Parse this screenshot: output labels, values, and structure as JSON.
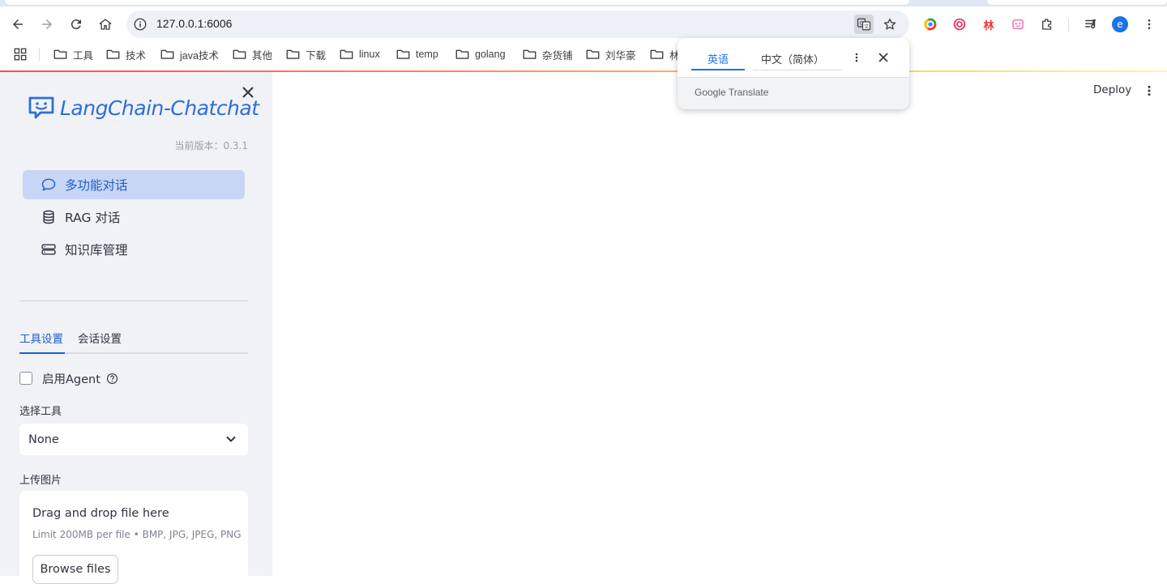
{
  "browser": {
    "url": "127.0.0.1:6006",
    "bookmarks": [
      {
        "label": "工具"
      },
      {
        "label": "技术"
      },
      {
        "label": "java技术"
      },
      {
        "label": "其他"
      },
      {
        "label": "下载"
      },
      {
        "label": "linux"
      },
      {
        "label": "temp"
      },
      {
        "label": "golang"
      },
      {
        "label": "杂货铺"
      },
      {
        "label": "刘华豪"
      },
      {
        "label": "林"
      }
    ],
    "extensions": {
      "lin_label": "林",
      "profile_initial": "e"
    },
    "icons": [
      "back-icon",
      "forward-icon",
      "reload-icon",
      "home-icon",
      "info-icon",
      "translate-icon",
      "star-icon",
      "extensions-icon",
      "media-icon",
      "kebab-menu-icon",
      "apps-icon",
      "folder-icon"
    ]
  },
  "translate_popup": {
    "source_language": "英语",
    "target_language": "中文（简体）",
    "brand": "Google Translate"
  },
  "sidebar": {
    "logo_text": "LangChain-Chatchat",
    "version": "当前版本：0.3.1",
    "menu": [
      {
        "label": "多功能对话",
        "icon": "chat-bubble-icon",
        "active": true
      },
      {
        "label": "RAG 对话",
        "icon": "database-icon",
        "active": false
      },
      {
        "label": "知识库管理",
        "icon": "server-icon",
        "active": false
      }
    ],
    "tabs": [
      {
        "label": "工具设置",
        "active": true
      },
      {
        "label": "会话设置",
        "active": false
      }
    ],
    "agent": {
      "label": "启用Agent",
      "checked": false
    },
    "tool_select": {
      "label": "选择工具",
      "value": "None"
    },
    "upload": {
      "label": "上传图片",
      "title": "Drag and drop file here",
      "limit": "Limit 200MB per file • BMP, JPG, JPEG, PNG",
      "button": "Browse files"
    }
  },
  "main": {
    "deploy_label": "Deploy"
  },
  "colors": {
    "accent": "#1d5fc9",
    "active_menu_bg": "#c7d6f4",
    "sidebar_bg": "#f0f2f6",
    "profile": "#1a73e8"
  }
}
